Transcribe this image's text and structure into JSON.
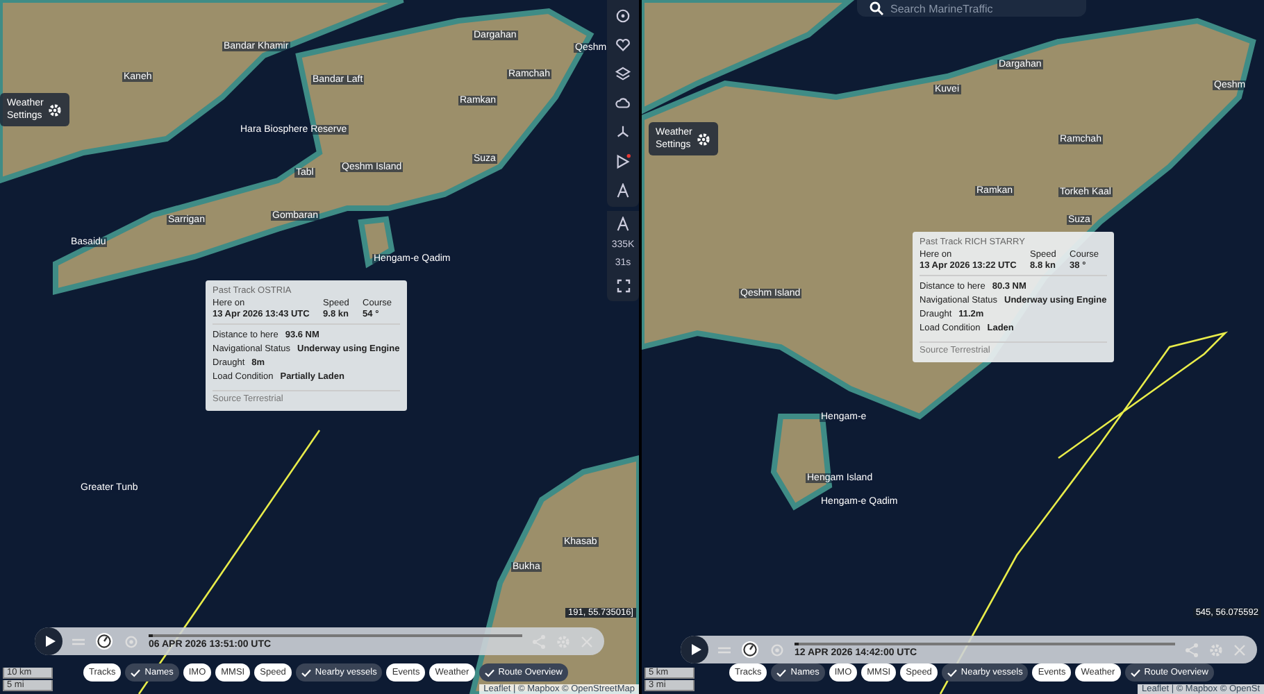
{
  "panels": [
    {
      "map_labels": [
        "Bandar Khamir",
        "Kaneh",
        "Bandar Laft",
        "Hara Biosphere Reserve",
        "Dargahan",
        "Qeshm",
        "Ramchah",
        "Ramkan",
        "Qeshm Island",
        "Tabl",
        "Suza",
        "Sarrigan",
        "Gombaran",
        "Basaidu",
        "Hengam-e Qadim",
        "Greater Tunb",
        "Khasab",
        "Bukha"
      ],
      "weather_settings": "Weather Settings",
      "toolbar": {
        "alert_dot": true,
        "stats": [
          "335K",
          "31s"
        ]
      },
      "popup": {
        "title": "Past Track OSTRIA",
        "here_on": "Here on",
        "speed_label": "Speed",
        "course_label": "Course",
        "time": "13 Apr 2026 13:43 UTC",
        "speed": "9.8 kn",
        "course": "54 °",
        "rows": [
          {
            "label": "Distance to here",
            "value": "93.6 NM"
          },
          {
            "label": "Navigational Status",
            "value": "Underway using Engine"
          },
          {
            "label": "Draught",
            "value": "8m"
          },
          {
            "label": "Load Condition",
            "value": "Partially Laden"
          }
        ],
        "source": "Source Terrestrial"
      },
      "player": {
        "date": "06 APR 2026 13:51:00 UTC",
        "level": 0.01
      },
      "chips": [
        {
          "label": "Tracks",
          "selected": false
        },
        {
          "label": "Names",
          "selected": true
        },
        {
          "label": "IMO",
          "selected": false
        },
        {
          "label": "MMSI",
          "selected": false
        },
        {
          "label": "Speed",
          "selected": false
        },
        {
          "label": "Nearby vessels",
          "selected": true
        },
        {
          "label": "Events",
          "selected": false
        },
        {
          "label": "Weather",
          "selected": false
        },
        {
          "label": "Route Overview",
          "selected": true
        }
      ],
      "scale": [
        "10 km",
        "5 mi"
      ],
      "coordinates": "191, 55.735016]",
      "attribution": "Leaflet | © Mapbox © OpenStreetMap"
    },
    {
      "search": {
        "placeholder": "Search MarineTraffic"
      },
      "map_labels": [
        "Dargahan",
        "Kuvei",
        "Qeshm",
        "Ramchah",
        "Ramkan",
        "Torkeh Kaal",
        "Suza",
        "Qeshm Island",
        "Hengam-e",
        "Hengam Island",
        "Hengam-e Qadim"
      ],
      "weather_settings": "Weather Settings",
      "popup": {
        "title": "Past Track RICH STARRY",
        "here_on": "Here on",
        "speed_label": "Speed",
        "course_label": "Course",
        "time": "13 Apr 2026 13:22 UTC",
        "speed": "8.8 kn",
        "course": "38 °",
        "rows": [
          {
            "label": "Distance to here",
            "value": "80.3 NM"
          },
          {
            "label": "Navigational Status",
            "value": "Underway using Engine"
          },
          {
            "label": "Draught",
            "value": "11.2m"
          },
          {
            "label": "Load Condition",
            "value": "Laden"
          }
        ],
        "source": "Source Terrestrial"
      },
      "player": {
        "date": "12 APR 2026 14:42:00 UTC",
        "level": 0.01
      },
      "chips": [
        {
          "label": "Tracks",
          "selected": false
        },
        {
          "label": "Names",
          "selected": true
        },
        {
          "label": "IMO",
          "selected": false
        },
        {
          "label": "MMSI",
          "selected": false
        },
        {
          "label": "Speed",
          "selected": false
        },
        {
          "label": "Nearby vessels",
          "selected": true
        },
        {
          "label": "Events",
          "selected": false
        },
        {
          "label": "Weather",
          "selected": false
        },
        {
          "label": "Route Overview",
          "selected": true
        }
      ],
      "scale": [
        "5 km",
        "3 mi"
      ],
      "coordinates": "545, 56.075592",
      "attribution": "Leaflet | © Mapbox © OpenSt"
    }
  ]
}
